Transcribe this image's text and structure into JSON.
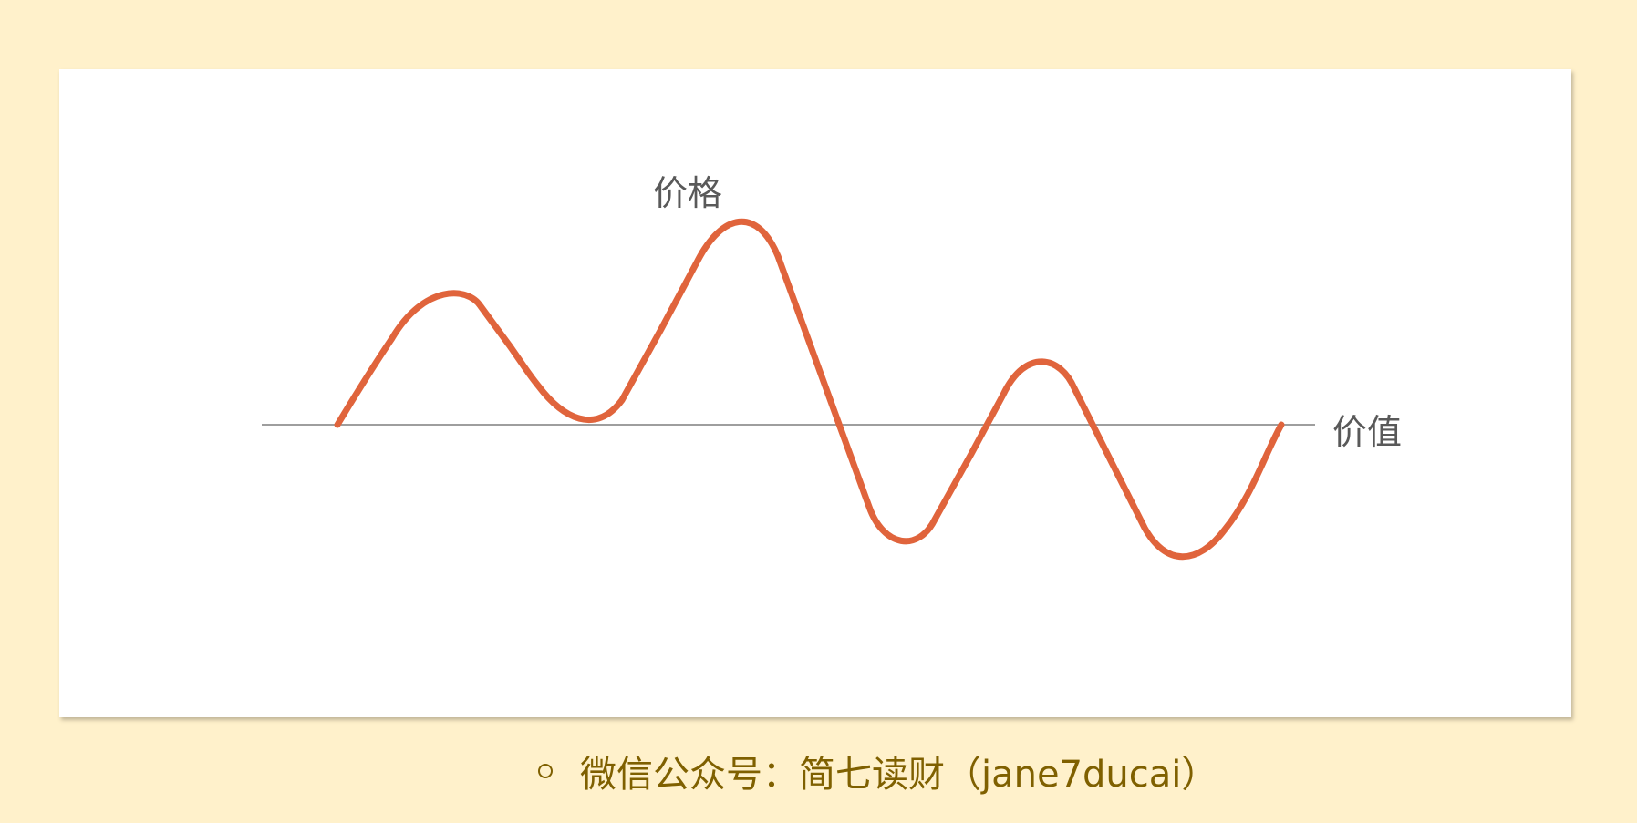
{
  "diagram": {
    "price_label": "价格",
    "value_label": "价值",
    "colors": {
      "background": "#fff1cb",
      "card": "#ffffff",
      "price_line": "#e0643c",
      "value_line": "#7f7f7f",
      "label_text": "#595959",
      "footer_text": "#7f6000"
    }
  },
  "footer": {
    "icon": "hollow-circle-bullet-icon",
    "text": "微信公众号：简七读财（jane7ducai）"
  }
}
